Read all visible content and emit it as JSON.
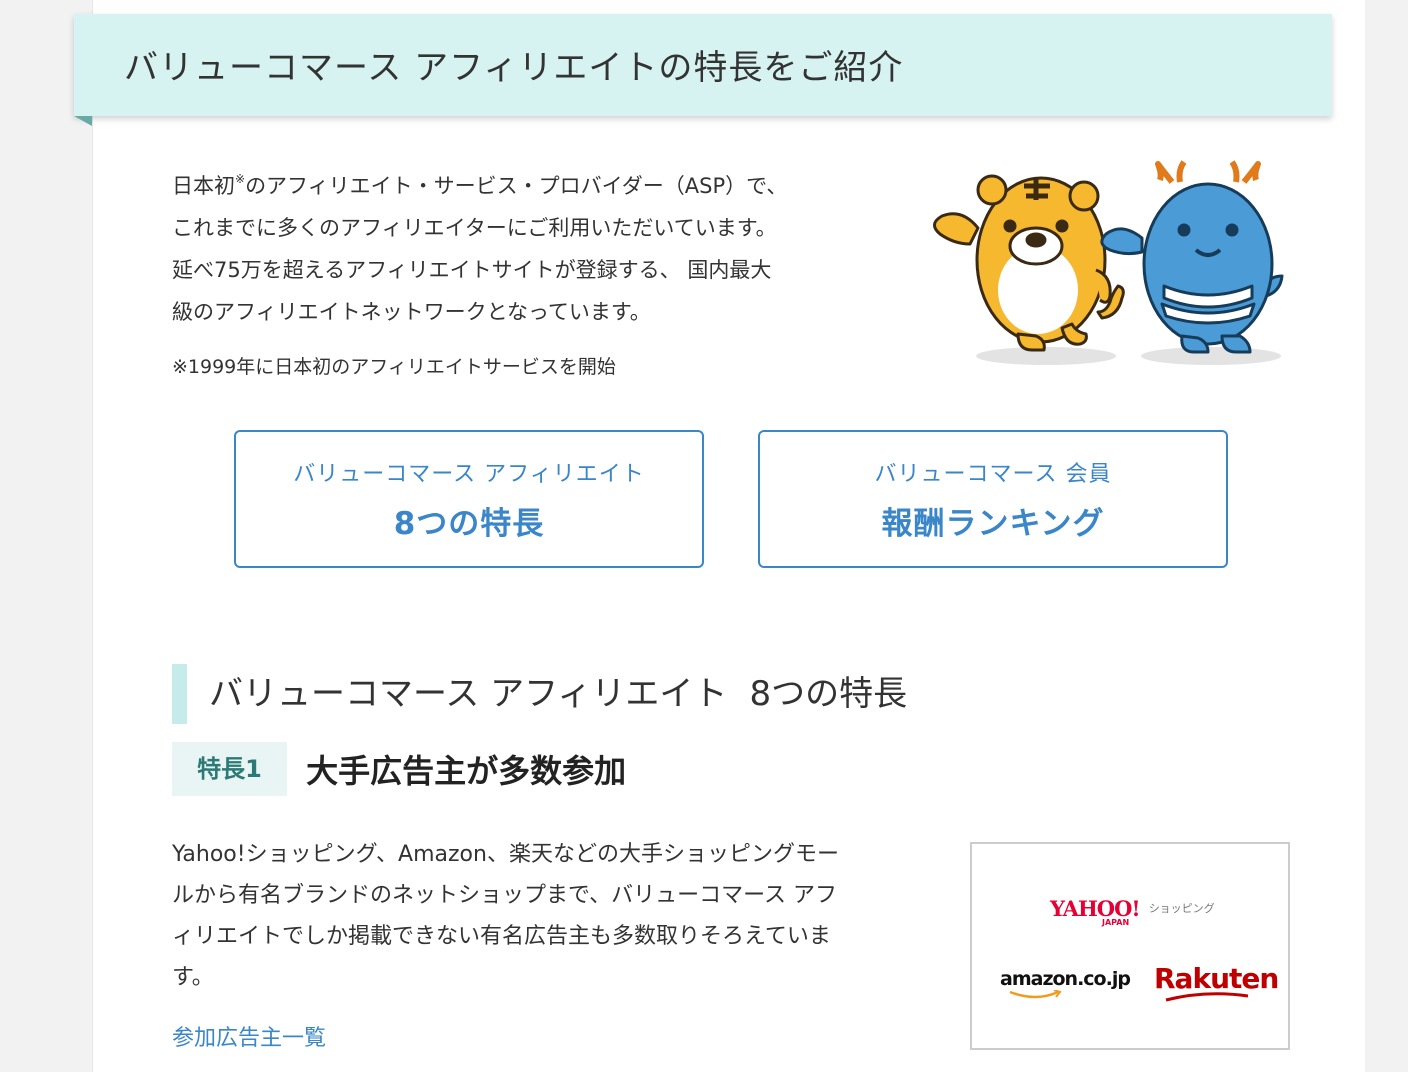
{
  "banner": {
    "title": "バリューコマース アフィリエイトの特長をご紹介"
  },
  "intro": {
    "lines": [
      "日本初",
      "※",
      "のアフィリエイト・サービス・プロバイダー（ASP）で、",
      "これまでに多くのアフィリエイターにご利用いただいています。",
      "延べ75万を超えるアフィリエイトサイトが登録する、 国内最大",
      "級のアフィリエイトネットワークとなっています。"
    ],
    "note": "※1999年に日本初のアフィリエイトサービスを開始"
  },
  "buttons": {
    "features": {
      "sub": "バリューコマース アフィリエイト",
      "main": "8つの特長"
    },
    "ranking": {
      "sub": "バリューコマース 会員",
      "main": "報酬ランキング"
    }
  },
  "section": {
    "title": "バリューコマース アフィリエイト",
    "emphasis": "8つの特長"
  },
  "feature1": {
    "tag": "特長1",
    "title": "大手広告主が多数参加",
    "lines": [
      "Yahoo!ショッピング、Amazon、楽天などの大手ショッピングモー",
      "ルから有名ブランドのネットショップまで、バリューコマース アフ",
      "ィリエイトでしか掲載できない有名広告主も多数取りそろえていま",
      "す。"
    ],
    "link": "参加広告主一覧",
    "logos": {
      "yahoo_main": "YAHOO!",
      "yahoo_sub": "JAPAN",
      "yahoo_shopping": "ショッピング",
      "amazon": "amazon.co.jp",
      "rakuten": "Rakuten"
    }
  },
  "colors": {
    "banner_bg": "#d6f3f2",
    "link_blue": "#3a86c8",
    "tag_bg": "#e8f5f4",
    "tag_text": "#2c7a75"
  }
}
